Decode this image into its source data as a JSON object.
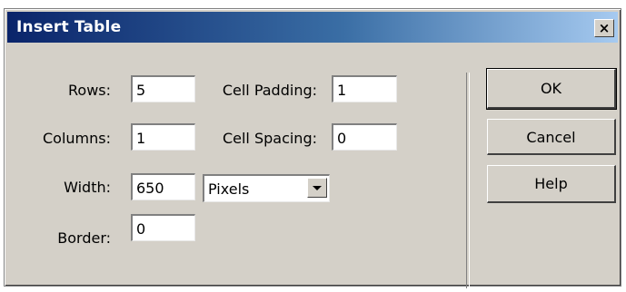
{
  "dialog": {
    "title": "Insert Table",
    "close_label": "×"
  },
  "fields": {
    "rows": {
      "label": "Rows:",
      "value": "5"
    },
    "columns": {
      "label": "Columns:",
      "value": "1"
    },
    "width": {
      "label": "Width:",
      "value": "650"
    },
    "border": {
      "label": "Border:",
      "value": "0"
    },
    "cell_padding": {
      "label": "Cell Padding:",
      "value": "1"
    },
    "cell_spacing": {
      "label": "Cell Spacing:",
      "value": "0"
    },
    "width_unit": {
      "selected": "Pixels"
    }
  },
  "buttons": {
    "ok": "OK",
    "cancel": "Cancel",
    "help": "Help"
  },
  "colors": {
    "title_gradient_start": "#0a246a",
    "title_gradient_end": "#a6caf0",
    "dialog_face": "#d4d0c8"
  }
}
